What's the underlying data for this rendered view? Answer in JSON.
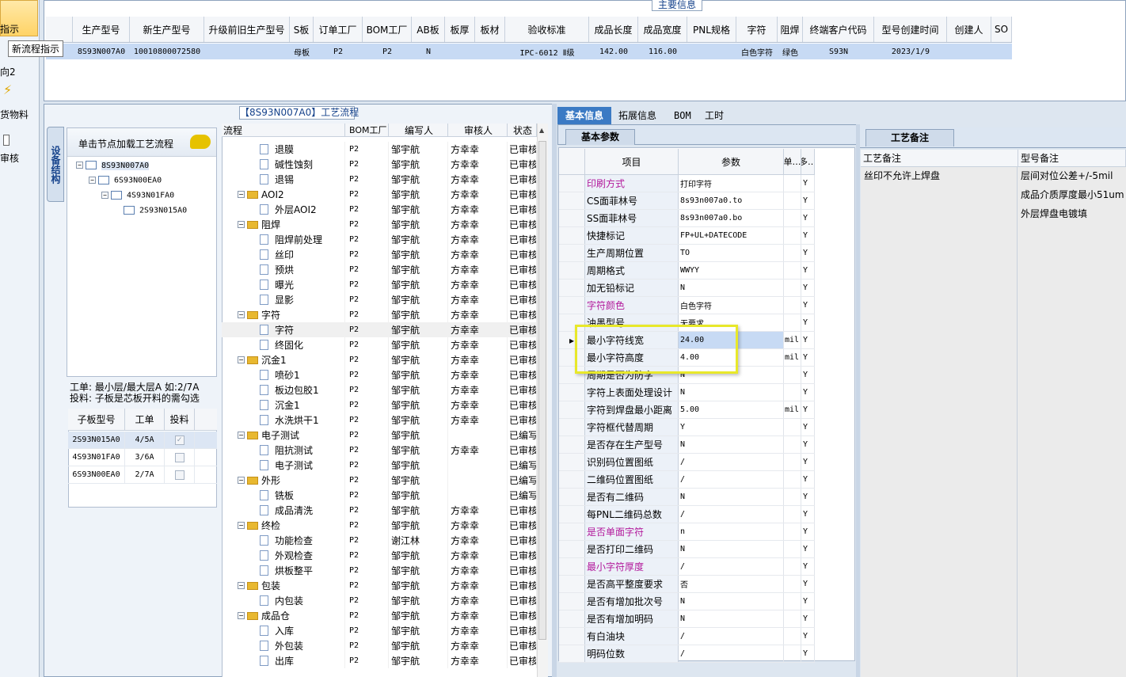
{
  "left_strip": {
    "items": [
      "指示",
      "向2",
      "货物料",
      "审核"
    ],
    "tooltip": "新流程指示"
  },
  "top_panel": {
    "title": "主要信息",
    "columns": [
      "生产型号",
      "新生产型号",
      "升级前旧生产型号",
      "S板",
      "订单工厂",
      "BOM工厂",
      "AB板",
      "板厚",
      "板材",
      "验收标准",
      "成品长度",
      "成品宽度",
      "PNL规格",
      "字符",
      "阻焊",
      "终端客户代码",
      "型号创建时间",
      "创建人",
      "SO"
    ],
    "row": [
      "8S93N007A0",
      "10010800072580",
      "",
      "母板",
      "P2",
      "P2",
      "N",
      "",
      "",
      "IPC-6012 Ⅱ级",
      "142.00",
      "116.00",
      "",
      "白色字符",
      "绿色",
      "S93N",
      "2023/1/9",
      "",
      ""
    ]
  },
  "flow_panel": {
    "title": "【8S93N007A0】工艺流程",
    "side_tab": "设备结构",
    "tree_header": "单击节点加载工艺流程",
    "tree": [
      "8S93N007A0",
      "6S93N00EA0",
      "4S93N01FA0",
      "2S93N015A0"
    ],
    "work_info_1": "工单: 最小层/最大层A 如:2/7A",
    "work_info_2": "投料: 子板是芯板开料的需勾选",
    "sub_columns": [
      "子板型号",
      "工单",
      "投料"
    ],
    "sub_rows": [
      {
        "model": "2S93N015A0",
        "order": "4/5A",
        "checked": true
      },
      {
        "model": "4S93N01FA0",
        "order": "3/6A",
        "checked": false
      },
      {
        "model": "6S93N00EA0",
        "order": "2/7A",
        "checked": false
      }
    ]
  },
  "flow_grid": {
    "columns": [
      "流程",
      "BOM工厂",
      "编写人",
      "审核人",
      "状态"
    ],
    "rows": [
      {
        "name": "退膜",
        "level": 2,
        "bom": "P2",
        "editor": "邹宇航",
        "auditor": "方幸幸",
        "status": "已审核"
      },
      {
        "name": "碱性蚀刻",
        "level": 2,
        "bom": "P2",
        "editor": "邹宇航",
        "auditor": "方幸幸",
        "status": "已审核"
      },
      {
        "name": "退锡",
        "level": 2,
        "bom": "P2",
        "editor": "邹宇航",
        "auditor": "方幸幸",
        "status": "已审核"
      },
      {
        "name": "AOI2",
        "level": 1,
        "bom": "P2",
        "editor": "邹宇航",
        "auditor": "方幸幸",
        "status": "已审核"
      },
      {
        "name": "外层AOI2",
        "level": 2,
        "bom": "P2",
        "editor": "邹宇航",
        "auditor": "方幸幸",
        "status": "已审核"
      },
      {
        "name": "阻焊",
        "level": 1,
        "bom": "P2",
        "editor": "邹宇航",
        "auditor": "方幸幸",
        "status": "已审核"
      },
      {
        "name": "阻焊前处理",
        "level": 2,
        "bom": "P2",
        "editor": "邹宇航",
        "auditor": "方幸幸",
        "status": "已审核"
      },
      {
        "name": "丝印",
        "level": 2,
        "bom": "P2",
        "editor": "邹宇航",
        "auditor": "方幸幸",
        "status": "已审核"
      },
      {
        "name": "预烘",
        "level": 2,
        "bom": "P2",
        "editor": "邹宇航",
        "auditor": "方幸幸",
        "status": "已审核"
      },
      {
        "name": "曝光",
        "level": 2,
        "bom": "P2",
        "editor": "邹宇航",
        "auditor": "方幸幸",
        "status": "已审核"
      },
      {
        "name": "显影",
        "level": 2,
        "bom": "P2",
        "editor": "邹宇航",
        "auditor": "方幸幸",
        "status": "已审核"
      },
      {
        "name": "字符",
        "level": 1,
        "bom": "P2",
        "editor": "邹宇航",
        "auditor": "方幸幸",
        "status": "已审核"
      },
      {
        "name": "字符",
        "level": 2,
        "bom": "P2",
        "editor": "邹宇航",
        "auditor": "方幸幸",
        "status": "已审核"
      },
      {
        "name": "终固化",
        "level": 2,
        "bom": "P2",
        "editor": "邹宇航",
        "auditor": "方幸幸",
        "status": "已审核"
      },
      {
        "name": "沉金1",
        "level": 1,
        "bom": "P2",
        "editor": "邹宇航",
        "auditor": "方幸幸",
        "status": "已审核"
      },
      {
        "name": "喷砂1",
        "level": 2,
        "bom": "P2",
        "editor": "邹宇航",
        "auditor": "方幸幸",
        "status": "已审核"
      },
      {
        "name": "板边包胶1",
        "level": 2,
        "bom": "P2",
        "editor": "邹宇航",
        "auditor": "方幸幸",
        "status": "已审核"
      },
      {
        "name": "沉金1",
        "level": 2,
        "bom": "P2",
        "editor": "邹宇航",
        "auditor": "方幸幸",
        "status": "已审核"
      },
      {
        "name": "水洗烘干1",
        "level": 2,
        "bom": "P2",
        "editor": "邹宇航",
        "auditor": "方幸幸",
        "status": "已审核"
      },
      {
        "name": "电子测试",
        "level": 1,
        "bom": "P2",
        "editor": "邹宇航",
        "auditor": "",
        "status": "已编写"
      },
      {
        "name": "阻抗测试",
        "level": 2,
        "bom": "P2",
        "editor": "邹宇航",
        "auditor": "方幸幸",
        "status": "已审核"
      },
      {
        "name": "电子测试",
        "level": 2,
        "bom": "P2",
        "editor": "邹宇航",
        "auditor": "",
        "status": "已编写"
      },
      {
        "name": "外形",
        "level": 1,
        "bom": "P2",
        "editor": "邹宇航",
        "auditor": "",
        "status": "已编写"
      },
      {
        "name": "铣板",
        "level": 2,
        "bom": "P2",
        "editor": "邹宇航",
        "auditor": "",
        "status": "已编写"
      },
      {
        "name": "成品清洗",
        "level": 2,
        "bom": "P2",
        "editor": "邹宇航",
        "auditor": "方幸幸",
        "status": "已审核"
      },
      {
        "name": "终检",
        "level": 1,
        "bom": "P2",
        "editor": "邹宇航",
        "auditor": "方幸幸",
        "status": "已审核"
      },
      {
        "name": "功能检查",
        "level": 2,
        "bom": "P2",
        "editor": "谢江林",
        "auditor": "方幸幸",
        "status": "已审核"
      },
      {
        "name": "外观检查",
        "level": 2,
        "bom": "P2",
        "editor": "邹宇航",
        "auditor": "方幸幸",
        "status": "已审核"
      },
      {
        "name": "烘板整平",
        "level": 2,
        "bom": "P2",
        "editor": "邹宇航",
        "auditor": "方幸幸",
        "status": "已审核"
      },
      {
        "name": "包装",
        "level": 1,
        "bom": "P2",
        "editor": "邹宇航",
        "auditor": "方幸幸",
        "status": "已审核"
      },
      {
        "name": "内包装",
        "level": 2,
        "bom": "P2",
        "editor": "邹宇航",
        "auditor": "方幸幸",
        "status": "已审核"
      },
      {
        "name": "成品仓",
        "level": 1,
        "bom": "P2",
        "editor": "邹宇航",
        "auditor": "方幸幸",
        "status": "已审核"
      },
      {
        "name": "入库",
        "level": 2,
        "bom": "P2",
        "editor": "邹宇航",
        "auditor": "方幸幸",
        "status": "已审核"
      },
      {
        "name": "外包装",
        "level": 2,
        "bom": "P2",
        "editor": "邹宇航",
        "auditor": "方幸幸",
        "status": "已审核"
      },
      {
        "name": "出库",
        "level": 2,
        "bom": "P2",
        "editor": "邹宇航",
        "auditor": "方幸幸",
        "status": "已审核"
      }
    ]
  },
  "right_tabs": [
    "基本信息",
    "拓展信息",
    "BOM",
    "工时"
  ],
  "params": {
    "subtab": "基本参数",
    "columns": [
      "项目",
      "参数",
      "单…",
      "多…"
    ],
    "rows": [
      {
        "item": "印刷方式",
        "value": "打印字符",
        "unit": "",
        "flag": "Y",
        "highlight": true
      },
      {
        "item": "CS面菲林号",
        "value": "8s93n007a0.to",
        "unit": "",
        "flag": "Y",
        "highlight": false
      },
      {
        "item": "SS面菲林号",
        "value": "8s93n007a0.bo",
        "unit": "",
        "flag": "Y",
        "highlight": false
      },
      {
        "item": "快捷标记",
        "value": "FP+UL+DATECODE",
        "unit": "",
        "flag": "Y",
        "highlight": false
      },
      {
        "item": "生产周期位置",
        "value": "TO",
        "unit": "",
        "flag": "Y",
        "highlight": false
      },
      {
        "item": "周期格式",
        "value": "WWYY",
        "unit": "",
        "flag": "Y",
        "highlight": false
      },
      {
        "item": "加无铅标记",
        "value": "N",
        "unit": "",
        "flag": "Y",
        "highlight": false
      },
      {
        "item": "字符颜色",
        "value": "白色字符",
        "unit": "",
        "flag": "Y",
        "highlight": true
      },
      {
        "item": "油墨型号",
        "value": "无要求",
        "unit": "",
        "flag": "Y",
        "highlight": false
      },
      {
        "item": "最小字符线宽",
        "value": "24.00",
        "unit": "mil",
        "flag": "Y",
        "highlight": false
      },
      {
        "item": "最小字符高度",
        "value": "4.00",
        "unit": "mil",
        "flag": "Y",
        "highlight": false
      },
      {
        "item": "周期是否为防字",
        "value": "N",
        "unit": "",
        "flag": "Y",
        "highlight": false
      },
      {
        "item": "字符上表面处理设计",
        "value": "N",
        "unit": "",
        "flag": "Y",
        "highlight": false
      },
      {
        "item": "字符到焊盘最小距离",
        "value": "5.00",
        "unit": "mil",
        "flag": "Y",
        "highlight": false
      },
      {
        "item": "字符框代替周期",
        "value": "Y",
        "unit": "",
        "flag": "Y",
        "highlight": false
      },
      {
        "item": "是否存在生产型号",
        "value": "N",
        "unit": "",
        "flag": "Y",
        "highlight": false
      },
      {
        "item": "识别码位置图纸",
        "value": "/",
        "unit": "",
        "flag": "Y",
        "highlight": false
      },
      {
        "item": "二维码位置图纸",
        "value": "/",
        "unit": "",
        "flag": "Y",
        "highlight": false
      },
      {
        "item": "是否有二维码",
        "value": "N",
        "unit": "",
        "flag": "Y",
        "highlight": false
      },
      {
        "item": "每PNL二维码总数",
        "value": "/",
        "unit": "",
        "flag": "Y",
        "highlight": false
      },
      {
        "item": "是否单面字符",
        "value": "n",
        "unit": "",
        "flag": "Y",
        "highlight": true
      },
      {
        "item": "是否打印二维码",
        "value": "N",
        "unit": "",
        "flag": "Y",
        "highlight": false
      },
      {
        "item": "最小字符厚度",
        "value": "/",
        "unit": "",
        "flag": "Y",
        "highlight": true
      },
      {
        "item": "是否高平整度要求",
        "value": "否",
        "unit": "",
        "flag": "Y",
        "highlight": false
      },
      {
        "item": "是否有增加批次号",
        "value": "N",
        "unit": "",
        "flag": "Y",
        "highlight": false
      },
      {
        "item": "是否有增加明码",
        "value": "N",
        "unit": "",
        "flag": "Y",
        "highlight": false
      },
      {
        "item": "有白油块",
        "value": "/",
        "unit": "",
        "flag": "Y",
        "highlight": false
      },
      {
        "item": "明码位数",
        "value": "/",
        "unit": "",
        "flag": "Y",
        "highlight": false
      }
    ]
  },
  "remarks": {
    "tab": "工艺备注",
    "columns": [
      "工艺备注",
      "型号备注"
    ],
    "process_notes": [
      "丝印不允许上焊盘"
    ],
    "model_notes": [
      "层间对位公差+/-5mil",
      "成品介质厚度最小51um",
      "外层焊盘电镀填"
    ]
  }
}
